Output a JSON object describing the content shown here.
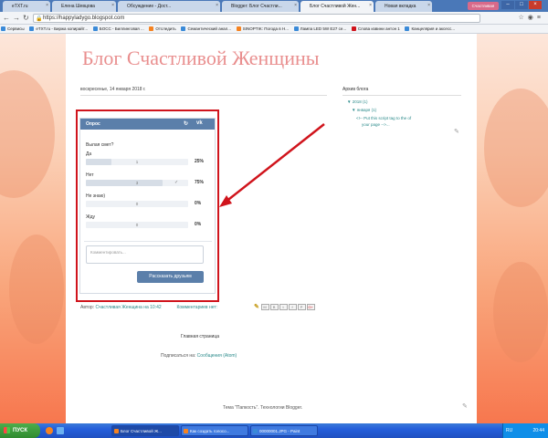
{
  "browser": {
    "tabs": [
      {
        "label": "eTXT.ru",
        "color": "#3a8ad8"
      },
      {
        "label": "Елена Шевцова",
        "color": "#3a8ad8"
      },
      {
        "label": "Обсуждение - Дост...",
        "color": "#3a8ad8"
      },
      {
        "label": "Blogger: Блог Счастли...",
        "color": "#f58220"
      },
      {
        "label": "Блог Счастливой Жен...",
        "color": "#f58220"
      },
      {
        "label": "Новая вкладка",
        "color": "#ffffff"
      }
    ],
    "user_badge": "Счастливая",
    "url": "https://happyladygo.blogspot.com",
    "bookmarks": [
      {
        "label": "Сервисы",
        "color": "#3a8ad8"
      },
      {
        "label": "eTXT.ru - Биржа копирайт...",
        "color": "#3a8ad8"
      },
      {
        "label": "БОСС - Биллинговая ...",
        "color": "#3a8ad8"
      },
      {
        "label": "Отследить",
        "color": "#f58220"
      },
      {
        "label": "Семантический анал...",
        "color": "#3a8ad8"
      },
      {
        "label": "SINOPTIK: Погода в Н...",
        "color": "#f58220"
      },
      {
        "label": "Лампа LED 5W E27 ce...",
        "color": "#3a8ad8"
      },
      {
        "label": "Слова извини антон 1",
        "color": "#d0141c"
      },
      {
        "label": "Канцелярия и аксесс...",
        "color": "#3a8ad8"
      }
    ]
  },
  "blog": {
    "title": "Блог Счастливой Женщины",
    "post_date": "воскресенье, 14 января 2018 г.",
    "author_prefix": "Автор:",
    "author": "Счастливая Женщина",
    "author_time_prefix": "на",
    "time": "10:42",
    "comments": "Комментариев нет:",
    "home": "Главная страница",
    "subscribe_prefix": "Подписаться на:",
    "subscribe_link": "Сообщения (Atom)",
    "theme": "Тема \"Папкость\". Технологии Blogger."
  },
  "sidebar": {
    "heading": "Архив блога",
    "items": [
      {
        "label": "▼ 2018 (1)"
      },
      {
        "label": "▼ января (1)"
      },
      {
        "label": "<!-- Put this script tag to the of"
      },
      {
        "label": "your page -->..."
      }
    ]
  },
  "poll": {
    "title": "Опрос",
    "question": "Вылая смет?",
    "options": [
      {
        "label": "Да",
        "count": "1",
        "percent": "25%",
        "share": 0.25,
        "checked": false
      },
      {
        "label": "Нет",
        "count": "3",
        "percent": "75%",
        "share": 0.75,
        "checked": true
      },
      {
        "label": "Не знаю)",
        "count": "0",
        "percent": "0%",
        "share": 0,
        "checked": false
      },
      {
        "label": "Жду",
        "count": "0",
        "percent": "0%",
        "share": 0,
        "checked": false
      }
    ],
    "comment_placeholder": "Комментировать...",
    "share_button": "Рассказать друзьям"
  },
  "taskbar": {
    "start": "ПУСК",
    "tasks": [
      {
        "label": "Блог Счастливой Ж...",
        "color": "#f58220"
      },
      {
        "label": "Как создать голосо...",
        "color": "#f58220"
      },
      {
        "label": "00000001.JPG - Paint",
        "color": "#3a8ad8"
      }
    ],
    "lang": "RU",
    "clock": "20:44"
  }
}
